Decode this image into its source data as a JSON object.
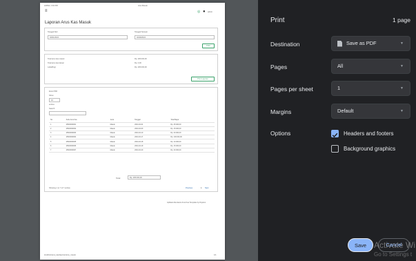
{
  "sheet": {
    "header_left": "2/28/22, 3:04 PM",
    "header_center": "Arus Masuk",
    "user_label": "admin",
    "page_title": "Laporan Arus Kas Masuk",
    "filter": {
      "date_from_label": "Tanggal Dari",
      "date_from_value": "02/01/2024",
      "date_to_label": "Tanggal Sampai",
      "date_to_value": "02/29/2024",
      "filter_button": "Filter"
    },
    "summary": {
      "rows": [
        {
          "label": "Total arus kas masuk",
          "value": "Rp. 205.000,00"
        },
        {
          "label": "Total arus kas keluar",
          "value": "Rp. 0,00"
        },
        {
          "label": "Laba/Rugi",
          "value": "Rp. 205.000,00"
        }
      ],
      "print_button": "Print Laporan"
    },
    "table_controls": {
      "export_options": "Excel  PDF",
      "show_label": "Show",
      "show_value": "10",
      "entries_label": "entries",
      "search_label": "Search:"
    },
    "table": {
      "headers": [
        "No",
        "Kode Arus Kas",
        "Jenis",
        "Tanggal",
        "Total Bayar"
      ],
      "rows": [
        [
          "1",
          "MSK0000001",
          "Masuk",
          "2024-02-01",
          "Rp. 25.000,00"
        ],
        [
          "2",
          "MSK0000002",
          "Masuk",
          "2024-02-03",
          "Rp. 15.000,00"
        ],
        [
          "3",
          "MSK0000003",
          "Masuk",
          "2024-02-10",
          "Rp. 20.000,00"
        ],
        [
          "4",
          "MSK0000004",
          "Masuk",
          "2024-02-17",
          "Rp. 100.000,00"
        ],
        [
          "5",
          "MSK0000005",
          "Masuk",
          "2024-02-18",
          "Rp. 10.000,00"
        ],
        [
          "6",
          "MSK0000006",
          "Masuk",
          "2024-02-19",
          "Rp. 15.000,00"
        ],
        [
          "7",
          "MSK0000007",
          "Masuk",
          "2024-02-20",
          "Rp. 20.000,00"
        ]
      ],
      "total_label": "Total",
      "total_value": "Rp. 205.000,00",
      "showing_text": "Showing 1 to 7 of 7 entries",
      "prev": "Previous",
      "page": "1",
      "next": "Next"
    },
    "footer_credit": "Aplikasi Akuntansi Arus Kas Template by Diyatno",
    "footer_url": "localhost/arus_kas/laporan/arus_masuk",
    "footer_page": "1/1"
  },
  "panel": {
    "title": "Print",
    "page_count": "1 page",
    "destination_label": "Destination",
    "destination_value": "Save as PDF",
    "pages_label": "Pages",
    "pages_value": "All",
    "pages_per_sheet_label": "Pages per sheet",
    "pages_per_sheet_value": "1",
    "margins_label": "Margins",
    "margins_value": "Default",
    "options_label": "Options",
    "headers_footers_label": "Headers and footers",
    "headers_footers_checked": true,
    "background_graphics_label": "Background graphics",
    "background_graphics_checked": false,
    "save_button": "Save",
    "cancel_button": "Cancel",
    "watermark_line1": "Activate Wi",
    "watermark_line2": "Go to Settings t",
    "accent_color": "#8ab4f8"
  }
}
